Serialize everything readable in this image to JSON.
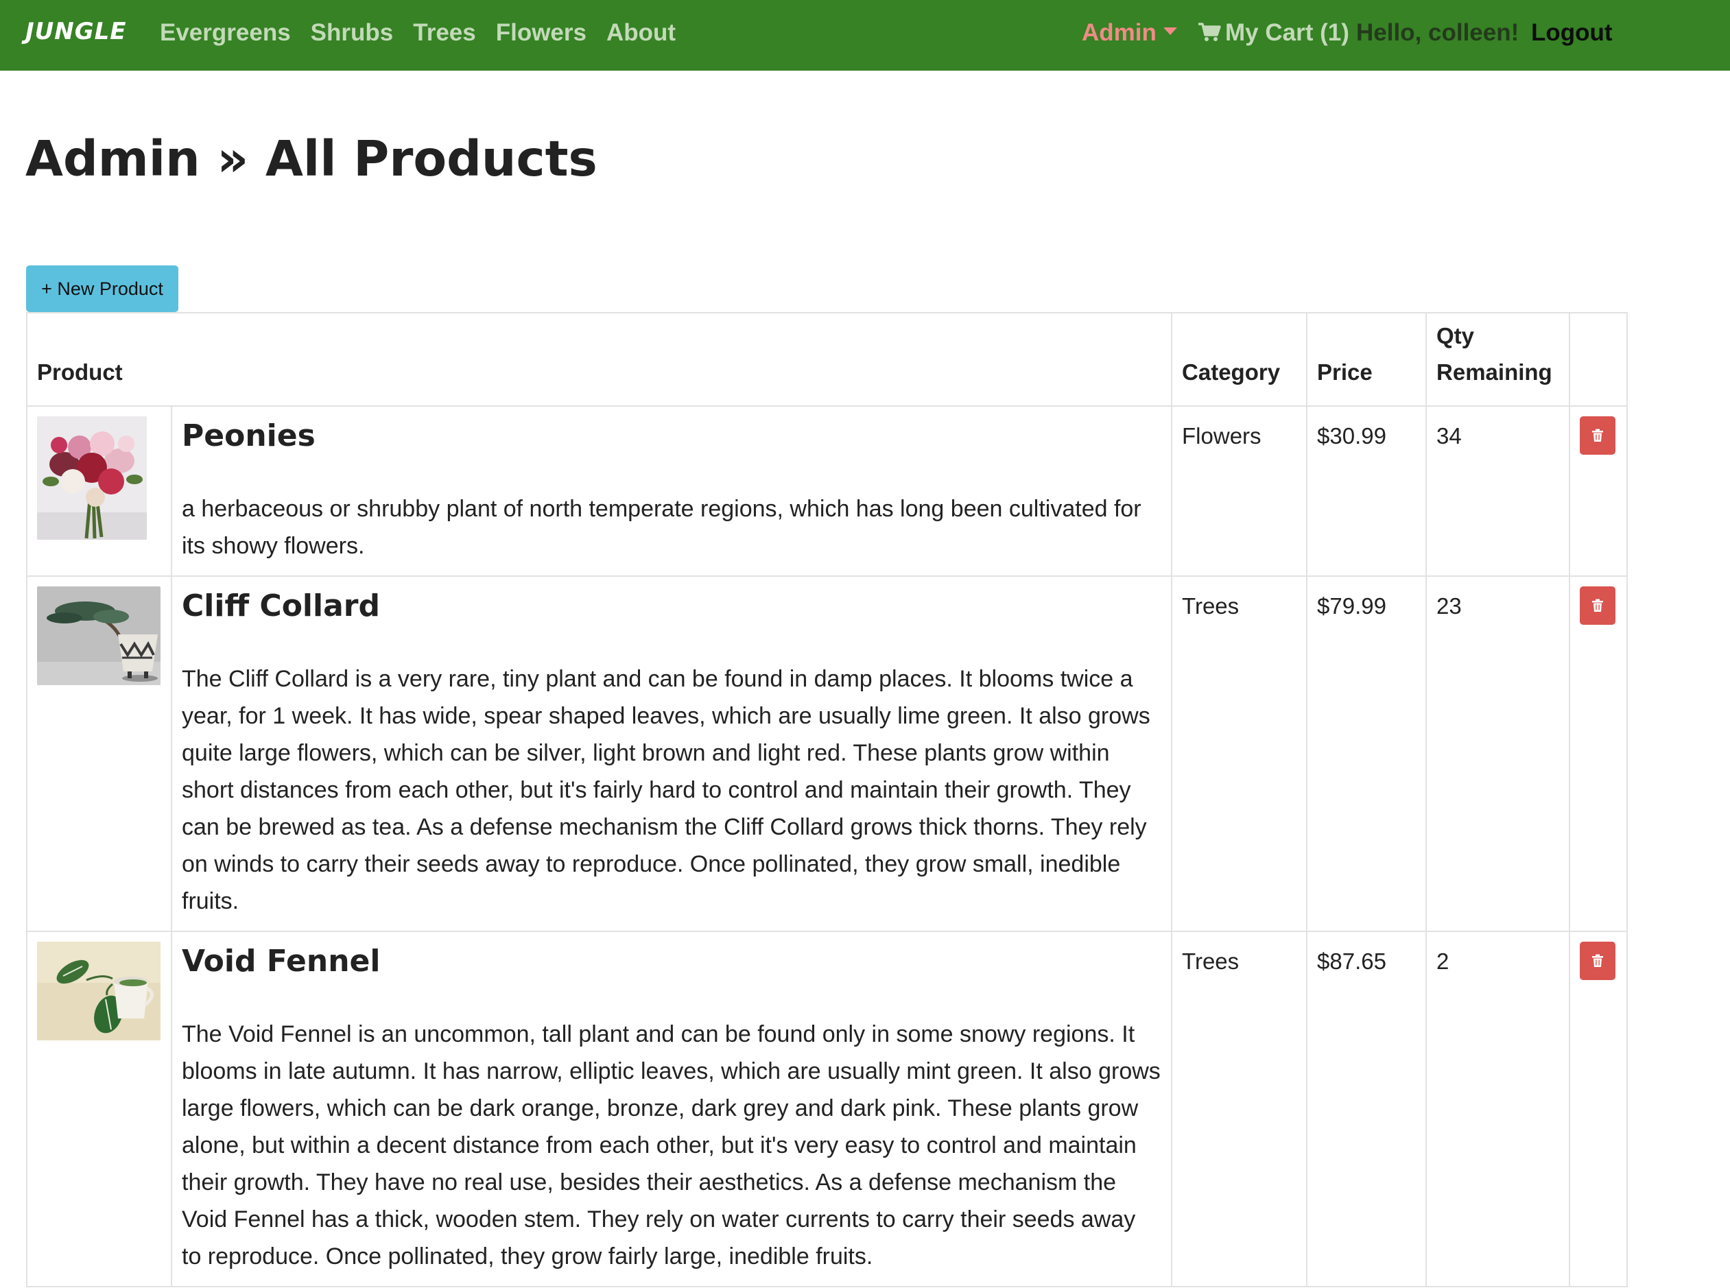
{
  "nav": {
    "brand": "JUNGLE",
    "links": [
      "Evergreens",
      "Shrubs",
      "Trees",
      "Flowers",
      "About"
    ],
    "admin_label": "Admin",
    "cart_label": "My Cart (1)",
    "greeting": "Hello, colleen!",
    "logout_label": "Logout",
    "icons": {
      "cart": "shopping-cart-icon",
      "admin_caret": "caret-down-icon"
    }
  },
  "page": {
    "title": "Admin » All Products",
    "new_product_label": "+ New Product"
  },
  "table": {
    "headers": {
      "product": "Product",
      "category": "Category",
      "price": "Price",
      "qty": "Qty Remaining"
    },
    "rows": [
      {
        "name": "Peonies",
        "description": "a herbaceous or shrubby plant of north temperate regions, which has long been cultivated for its showy flowers.",
        "category": "Flowers",
        "price": "$30.99",
        "qty": "34",
        "image": "peonies-bouquet-image"
      },
      {
        "name": "Cliff Collard",
        "description": "The Cliff Collard is a very rare, tiny plant and can be found in damp places. It blooms twice a year, for 1 week. It has wide, spear shaped leaves, which are usually lime green. It also grows quite large flowers, which can be silver, light brown and light red. These plants grow within short distances from each other, but it's fairly hard to control and maintain their growth. They can be brewed as tea. As a defense mechanism the Cliff Collard grows thick thorns. They rely on winds to carry their seeds away to reproduce. Once pollinated, they grow small, inedible fruits.",
        "category": "Trees",
        "price": "$79.99",
        "qty": "23",
        "image": "bonsai-pot-image"
      },
      {
        "name": "Void Fennel",
        "description": "The Void Fennel is an uncommon, tall plant and can be found only in some snowy regions. It blooms in late autumn. It has narrow, elliptic leaves, which are usually mint green. It also grows large flowers, which can be dark orange, bronze, dark grey and dark pink. These plants grow alone, but within a decent distance from each other, but it's very easy to control and maintain their growth. They have no real use, besides their aesthetics. As a defense mechanism the Void Fennel has a thick, wooden stem. They rely on water currents to carry their seeds away to reproduce. Once pollinated, they grow fairly large, inedible fruits.",
        "category": "Trees",
        "price": "$87.65",
        "qty": "2",
        "image": "pothos-cup-image"
      }
    ],
    "delete_icon": "trash-icon"
  },
  "colors": {
    "navbar": "#368225",
    "nav_link": "#c3dab8",
    "admin": "#f08b86",
    "new_button": "#5bc0de",
    "delete_button": "#d9534f"
  }
}
